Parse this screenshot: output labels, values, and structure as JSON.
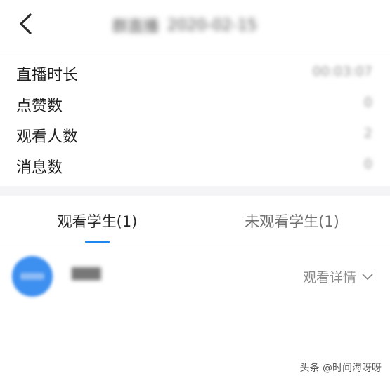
{
  "header": {
    "back_icon": "chevron-left-icon",
    "title": "群直播",
    "date": "2020-02-15"
  },
  "stats": [
    {
      "label": "直播时长",
      "value": "00:03:07"
    },
    {
      "label": "点赞数",
      "value": "0"
    },
    {
      "label": "观看人数",
      "value": "2"
    },
    {
      "label": "消息数",
      "value": "0"
    }
  ],
  "tabs": {
    "watched": "观看学生(1)",
    "unwatched": "未观看学生(1)",
    "active": "watched",
    "accent_color": "#1f87f0"
  },
  "student": {
    "name": "▇▇▇",
    "detail_label": "观看详情",
    "detail_icon": "chevron-down-icon"
  },
  "watermark": "头条 @时间海呀呀"
}
